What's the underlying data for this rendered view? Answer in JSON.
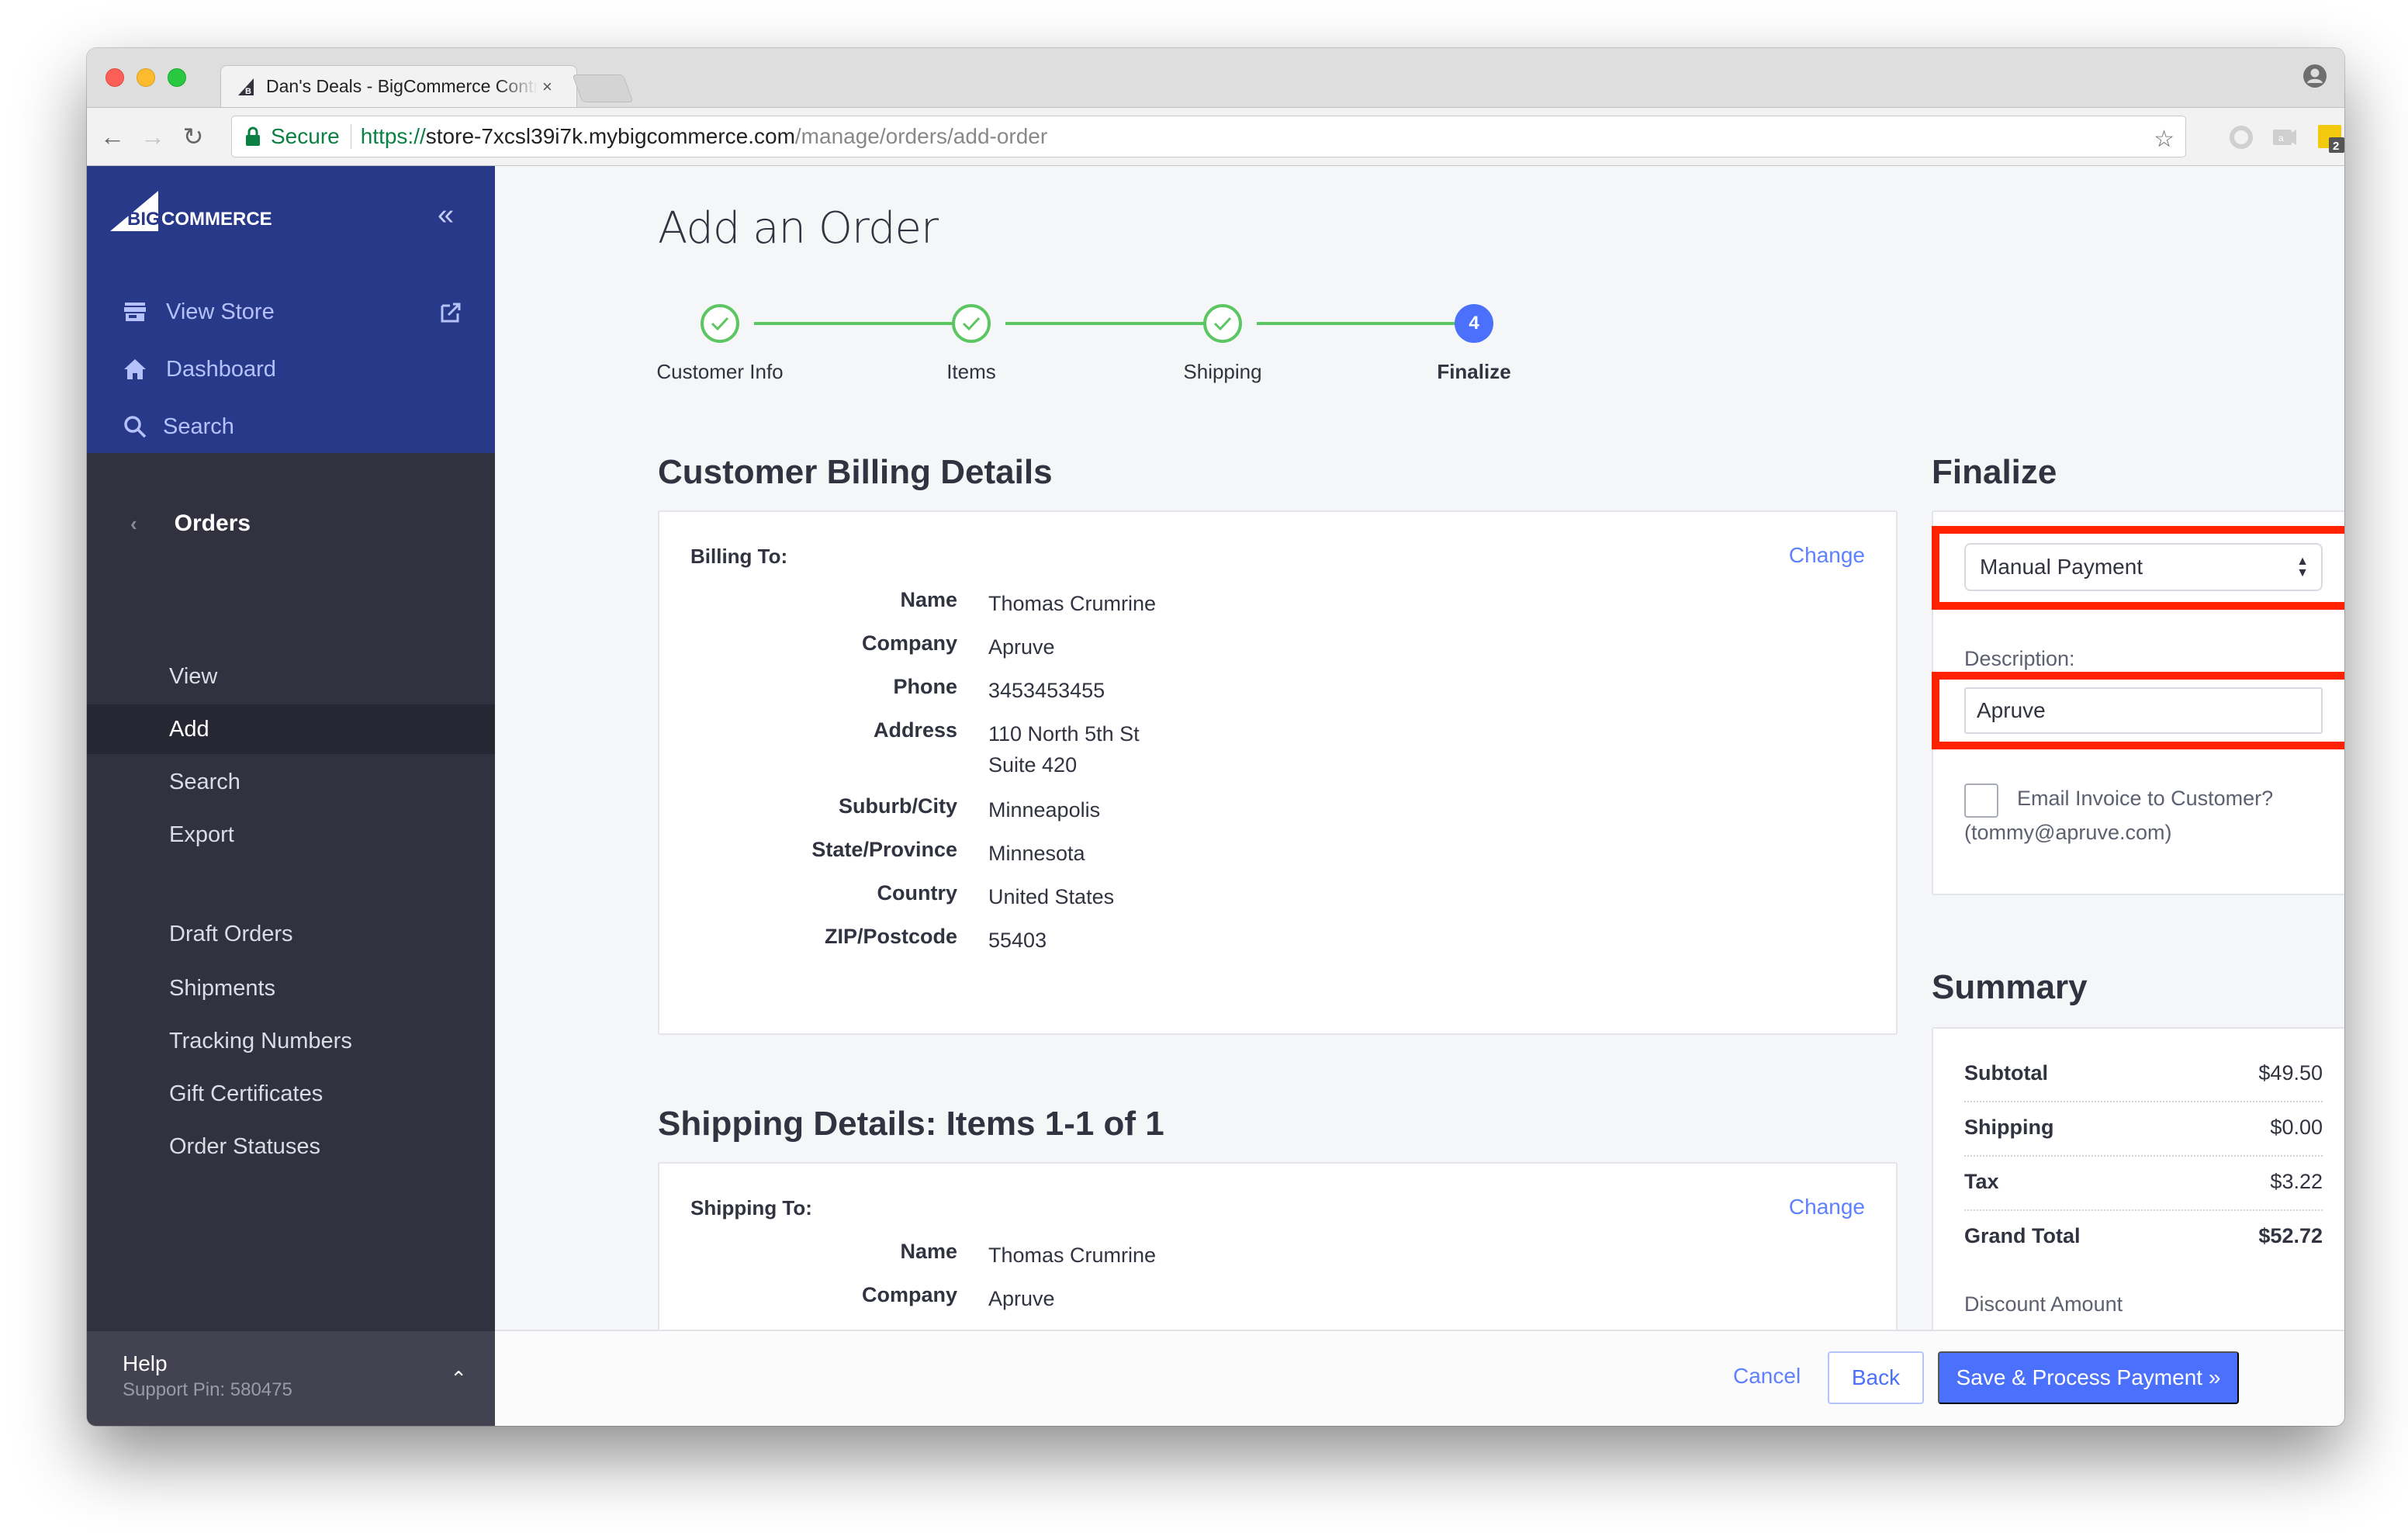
{
  "browser": {
    "tab_title": "Dan's Deals - BigCommerce Control Panel",
    "tab_close": "×",
    "secure_label": "Secure",
    "url_scheme": "https://",
    "url_host": "store-7xcsl39i7k.mybigcommerce.com",
    "url_path": "/manage/orders/add-order",
    "star_glyph": "☆",
    "back_glyph": "←",
    "forward_glyph": "→",
    "reload_glyph": "↻",
    "extension_badge": "2",
    "menu_glyph": "⋮"
  },
  "sidebar": {
    "collapse_glyph": "«",
    "logo_text_big": "BIG",
    "logo_text_commerce": "COMMERCE",
    "main_items": [
      {
        "label": "View Store",
        "icon": "store-icon"
      },
      {
        "label": "Dashboard",
        "icon": "home-icon"
      },
      {
        "label": "Search",
        "icon": "search-icon"
      }
    ],
    "section": {
      "back_glyph": "‹",
      "label": "Orders"
    },
    "sub_items": [
      {
        "label": "View"
      },
      {
        "label": "Add",
        "active": true
      },
      {
        "label": "Search"
      },
      {
        "label": "Export"
      },
      {
        "label": "Draft Orders"
      },
      {
        "label": "Shipments"
      },
      {
        "label": "Tracking Numbers"
      },
      {
        "label": "Gift Certificates"
      },
      {
        "label": "Order Statuses"
      }
    ],
    "help": {
      "title": "Help",
      "support_pin": "Support Pin: 580475",
      "chevron": "⌃"
    }
  },
  "page": {
    "title": "Add an Order",
    "steps": [
      {
        "label": "Customer Info",
        "status": "done"
      },
      {
        "label": "Items",
        "status": "done"
      },
      {
        "label": "Shipping",
        "status": "done"
      },
      {
        "label": "Finalize",
        "status": "current",
        "number": "4"
      }
    ],
    "billing": {
      "section_title": "Customer Billing Details",
      "card_label": "Billing To:",
      "change_label": "Change",
      "rows": [
        {
          "key": "Name",
          "value": "Thomas Crumrine"
        },
        {
          "key": "Company",
          "value": "Apruve"
        },
        {
          "key": "Phone",
          "value": "3453453455"
        },
        {
          "key": "Address",
          "value": "110 North 5th St",
          "value2": "Suite 420"
        },
        {
          "key": "Suburb/City",
          "value": "Minneapolis"
        },
        {
          "key": "State/Province",
          "value": "Minnesota"
        },
        {
          "key": "Country",
          "value": "United States"
        },
        {
          "key": "ZIP/Postcode",
          "value": "55403"
        }
      ]
    },
    "shipping": {
      "section_title": "Shipping Details: Items 1-1 of 1",
      "card_label": "Shipping To:",
      "change_label": "Change",
      "rows": [
        {
          "key": "Name",
          "value": "Thomas Crumrine"
        },
        {
          "key": "Company",
          "value": "Apruve"
        }
      ]
    },
    "finalize": {
      "section_title": "Finalize",
      "payment_method": "Manual Payment",
      "description_label": "Description:",
      "description_value": "Apruve",
      "email_invoice_label": "Email Invoice to Customer?",
      "email_invoice_checked": false,
      "customer_email": "(tommy@apruve.com)",
      "highlight_color": "#ff2200"
    },
    "summary": {
      "section_title": "Summary",
      "rows": [
        {
          "key": "Subtotal",
          "value": "$49.50"
        },
        {
          "key": "Shipping",
          "value": "$0.00"
        },
        {
          "key": "Tax",
          "value": "$3.22"
        },
        {
          "key": "Grand Total",
          "value": "$52.72"
        }
      ],
      "discount_label": "Discount Amount"
    }
  },
  "footer": {
    "cancel_label": "Cancel",
    "back_label": "Back",
    "save_label": "Save & Process Payment »"
  },
  "colors": {
    "sidebar_top": "#28398a",
    "sidebar_bg": "#313140",
    "primary": "#4b71fc",
    "step_done": "#5cc663",
    "link": "#5f80ff"
  }
}
